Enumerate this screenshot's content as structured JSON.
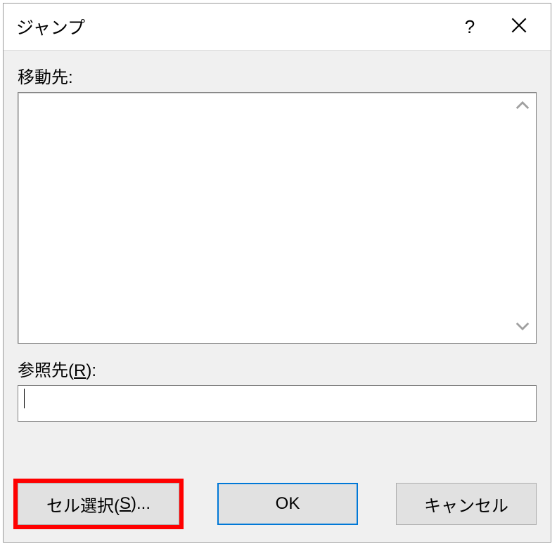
{
  "dialog": {
    "title": "ジャンプ",
    "help_tooltip": "?",
    "close_tooltip": "閉じる"
  },
  "goTo": {
    "label": "移動先:",
    "items": []
  },
  "reference": {
    "label_prefix": "参照先(",
    "label_mnemonic": "R",
    "label_suffix": "):",
    "value": ""
  },
  "buttons": {
    "special_prefix": "セル選択(",
    "special_mnemonic": "S",
    "special_suffix": ")...",
    "ok": "OK",
    "cancel": "キャンセル"
  }
}
